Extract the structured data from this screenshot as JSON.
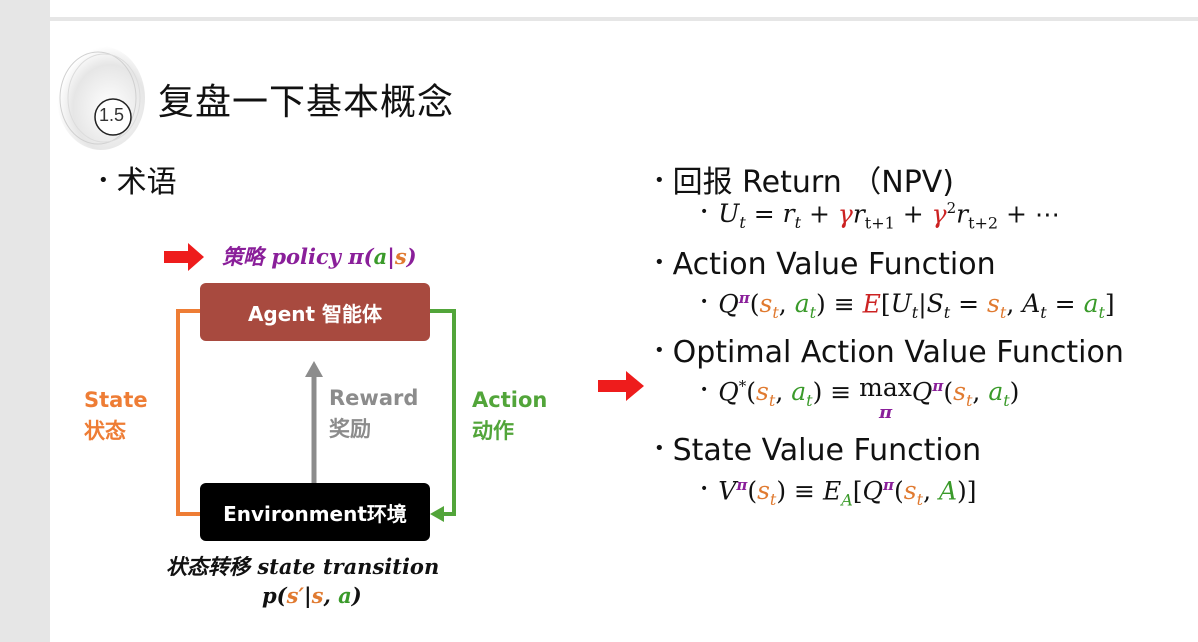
{
  "slide": {
    "section_number": "1.5",
    "title": "复盘一下基本概念",
    "left_heading": "术语",
    "diagram": {
      "policy_label_cn": "策略",
      "policy_label_en": "policy",
      "agent_box": "Agent 智能体",
      "environment_box": "Environment环境",
      "state_en": "State",
      "state_cn": "状态",
      "action_en": "Action",
      "action_cn": "动作",
      "reward_en": "Reward",
      "reward_cn": "奖励",
      "transition_cn": "状态转移",
      "transition_en": "state transition"
    },
    "right_items": [
      {
        "heading": "回报 Return （NPV)"
      },
      {
        "heading": "Action Value Function"
      },
      {
        "heading": "Optimal Action Value Function"
      },
      {
        "heading": "State Value Function"
      }
    ]
  },
  "colors": {
    "agent_box": "#a84a3f",
    "environment_box": "#000000",
    "state_arrow": "#ee7d35",
    "action_arrow": "#52a53a",
    "reward_arrow": "#8c8c8c",
    "pointer_arrow": "#ee1c1c",
    "purple": "#8a1f9a"
  },
  "icons": {
    "pointer": "red-right-arrow-icon",
    "badge": "circle-badge-icon"
  }
}
